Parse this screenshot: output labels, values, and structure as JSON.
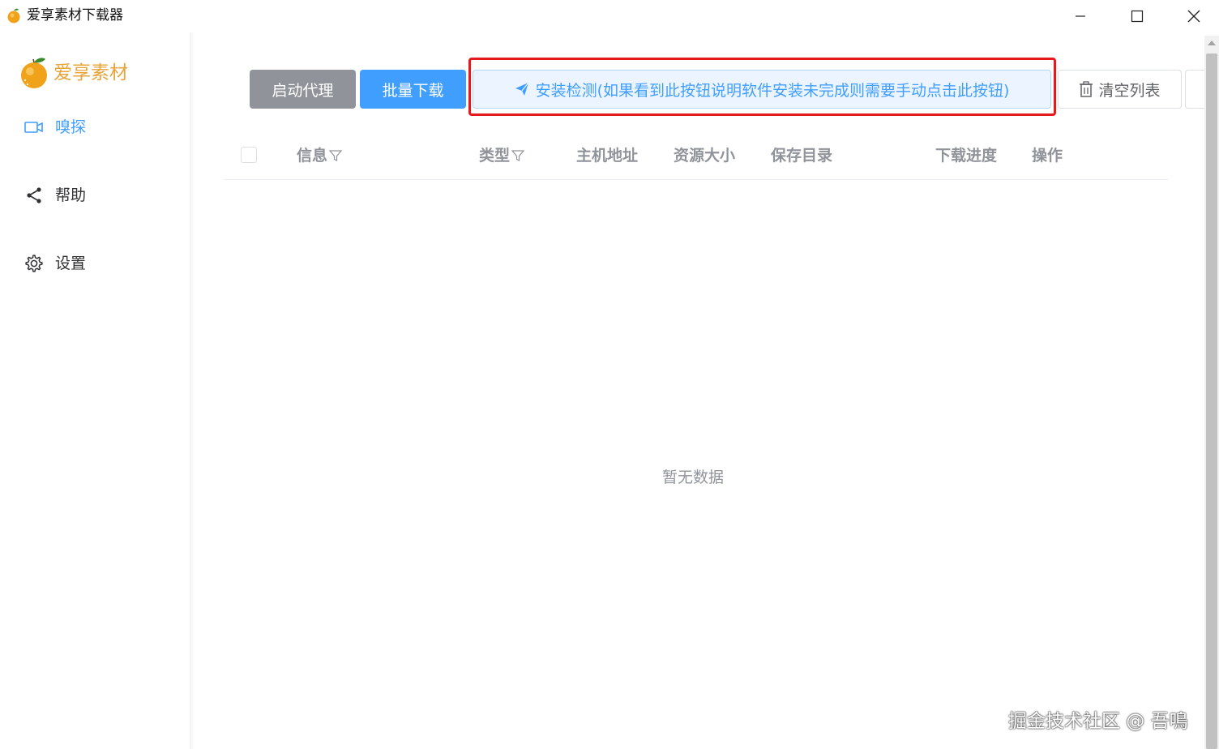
{
  "window": {
    "title": "爱享素材下载器"
  },
  "sidebar": {
    "logo_text": "爱享素材",
    "items": [
      {
        "label": "嗅探",
        "icon": "video-camera-icon",
        "active": true
      },
      {
        "label": "帮助",
        "icon": "share-icon",
        "active": false
      },
      {
        "label": "设置",
        "icon": "gear-icon",
        "active": false
      }
    ]
  },
  "toolbar": {
    "proxy_label": "启动代理",
    "batch_label": "批量下载",
    "check_label": "安装检测(如果看到此按钮说明软件安装未完成则需要手动点击此按钮)",
    "clear_label": "清空列表"
  },
  "table": {
    "columns": [
      "信息",
      "类型",
      "主机地址",
      "资源大小",
      "保存目录",
      "下载进度",
      "操作"
    ],
    "empty_text": "暂无数据"
  },
  "watermark": "掘金技术社区 @ 吾鳴",
  "colors": {
    "primary": "#409eff",
    "info": "#909399",
    "highlight": "#e6191e",
    "brand": "#e8a33b"
  }
}
